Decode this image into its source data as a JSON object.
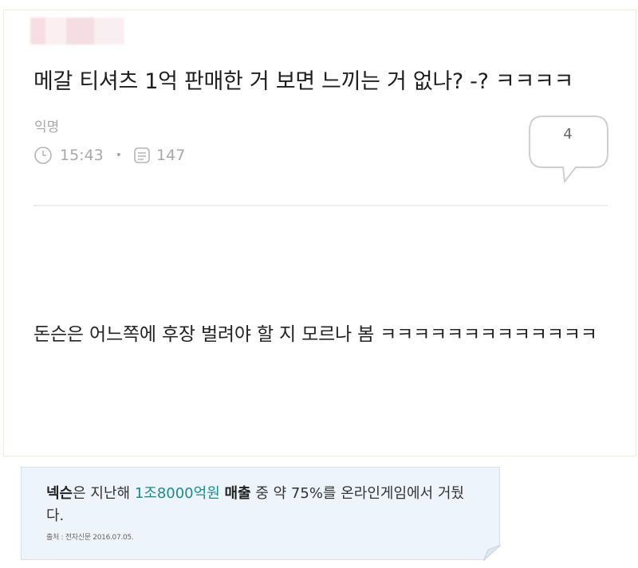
{
  "post": {
    "title": "메갈 티셔츠 1억 판매한 거 보면 느끼는 거 없나? -? ㅋㅋㅋㅋ",
    "author": "익명",
    "time": "15:43",
    "views": "147",
    "comment_count": "4",
    "body": "돈슨은 어느쪽에 후장 벌려야 할 지 모르나 봄 ㅋㅋㅋㅋㅋㅋㅋㅋㅋㅋㅋㅋㅋ"
  },
  "icons": {
    "clock": "clock-icon",
    "views": "document-icon",
    "comments": "speech-bubble-icon"
  },
  "note": {
    "part1": "넥슨",
    "part2": "은 지난해 ",
    "part3": "1조8000억원",
    "part4": " ",
    "part5": "매출",
    "part6": " 중 약 75%를 온라인게임에서 거뒀다.",
    "source": "출처 : 전자신문 2016.07.05."
  },
  "colors": {
    "highlight": "#1a8a92",
    "note_bg": "#eef4fb"
  }
}
